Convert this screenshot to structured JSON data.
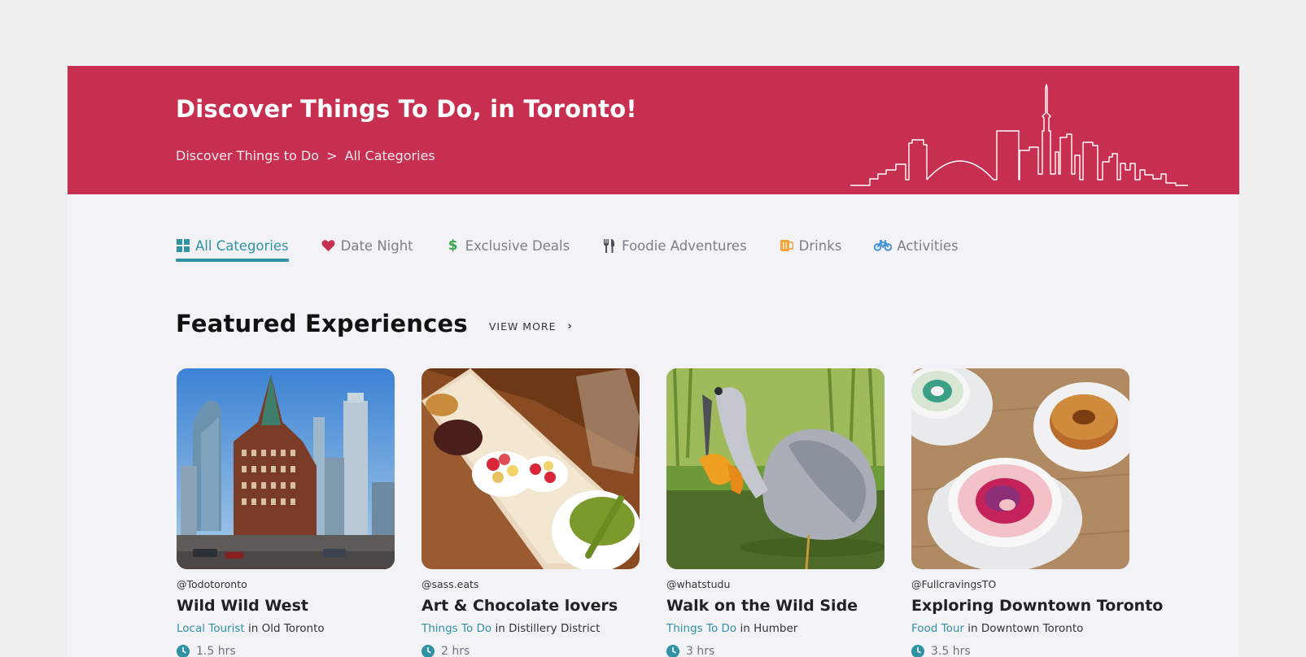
{
  "hero": {
    "title": "Discover Things To Do, in Toronto!",
    "breadcrumb": [
      "Discover Things to Do",
      ">",
      "All Categories"
    ]
  },
  "tabs": [
    {
      "label": "All Categories",
      "icon": "grid-icon",
      "active": true
    },
    {
      "label": "Date Night",
      "icon": "heart-icon"
    },
    {
      "label": "Exclusive Deals",
      "icon": "dollar-icon"
    },
    {
      "label": "Foodie Adventures",
      "icon": "utensils-icon"
    },
    {
      "label": "Drinks",
      "icon": "mug-icon"
    },
    {
      "label": "Activities",
      "icon": "bicycle-icon"
    }
  ],
  "featured": {
    "heading": "Featured Experiences",
    "view_more": "VIEW MORE"
  },
  "cards": [
    {
      "handle": "@Todotoronto",
      "title": "Wild Wild West",
      "category": "Local Tourist",
      "in": "in",
      "location": "Old Toronto",
      "duration": "1.5 hrs"
    },
    {
      "handle": "@sass.eats",
      "title": "Art & Chocolate lovers",
      "category": "Things To Do",
      "in": "in",
      "location": "Distillery District",
      "duration": "2 hrs"
    },
    {
      "handle": "@whatstudu",
      "title": "Walk on the Wild Side",
      "category": "Things To Do",
      "in": "in",
      "location": "Humber",
      "duration": "3 hrs"
    },
    {
      "handle": "@FullcravingsTO",
      "title": "Exploring Downtown Toronto",
      "category": "Food Tour",
      "in": "in",
      "location": "Downtown Toronto",
      "duration": "3.5 hrs"
    }
  ],
  "colors": {
    "brand": "#c62f50",
    "accent": "#2f93a4",
    "heart": "#c62f50",
    "dollar": "#3aa650",
    "mug": "#f2a33a",
    "bike": "#3b8fd8"
  }
}
